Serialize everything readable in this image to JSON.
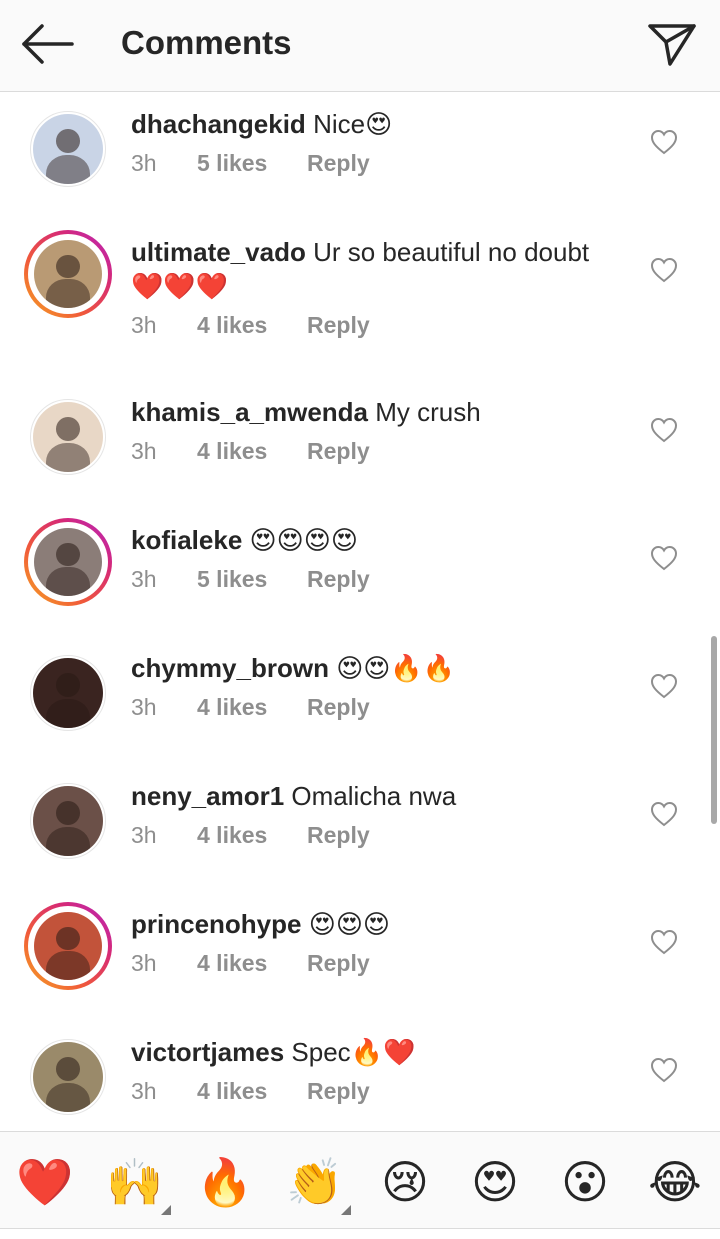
{
  "header": {
    "title": "Comments",
    "back_icon": "arrow-left-icon",
    "send_icon": "paper-plane-icon"
  },
  "comments": [
    {
      "username": "dhachangekid",
      "text": "Nice😍",
      "time": "3h",
      "likes": "5 likes",
      "reply": "Reply",
      "story": false,
      "avatar_color": "#c9d4e6"
    },
    {
      "username": "ultimate_vado",
      "text": "Ur so beautiful no doubt",
      "text2": "❤️❤️❤️",
      "time": "3h",
      "likes": "4 likes",
      "reply": "Reply",
      "story": true,
      "avatar_color": "#b99a74"
    },
    {
      "username": "khamis_a_mwenda",
      "text": "My crush",
      "time": "3h",
      "likes": "4 likes",
      "reply": "Reply",
      "story": false,
      "avatar_color": "#e8d7c6"
    },
    {
      "username": "kofialeke",
      "text": "😍😍😍😍",
      "time": "3h",
      "likes": "5 likes",
      "reply": "Reply",
      "story": true,
      "avatar_color": "#8b7d78"
    },
    {
      "username": "chymmy_brown",
      "text": "😍😍🔥🔥",
      "time": "3h",
      "likes": "4 likes",
      "reply": "Reply",
      "story": false,
      "avatar_color": "#3a2420"
    },
    {
      "username": "neny_amor1",
      "text": "Omalicha nwa",
      "time": "3h",
      "likes": "4 likes",
      "reply": "Reply",
      "story": false,
      "avatar_color": "#6b5048"
    },
    {
      "username": "princenohype",
      "text": "😍😍😍",
      "time": "3h",
      "likes": "4 likes",
      "reply": "Reply",
      "story": true,
      "avatar_color": "#c2533a"
    },
    {
      "username": "victortjames",
      "text": "Spec🔥❤️",
      "time": "3h",
      "likes": "4 likes",
      "reply": "Reply",
      "story": false,
      "avatar_color": "#9a8a6a"
    }
  ],
  "reactions": [
    "❤️",
    "🙌",
    "🔥",
    "👏",
    "😢",
    "😍",
    "😮",
    "😂"
  ],
  "colors": {
    "text": "#262626",
    "meta": "#8e8e8e",
    "divider": "#dbdbdb",
    "header_bg": "#fafafa"
  }
}
